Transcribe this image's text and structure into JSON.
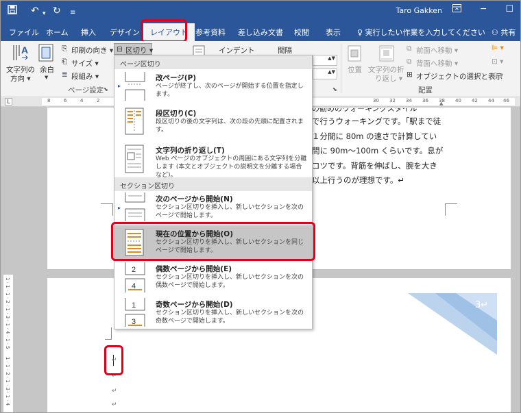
{
  "title_bar": {
    "user_name": "Taro Gakken",
    "qa_icons": [
      "save-icon",
      "undo-icon",
      "redo-icon",
      "customize-icon"
    ],
    "window_icons": [
      "ribbon-display-icon",
      "minimize-icon",
      "maximize-icon"
    ]
  },
  "tabs": [
    {
      "label": "ファイル"
    },
    {
      "label": "ホーム"
    },
    {
      "label": "挿入"
    },
    {
      "label": "デザイン"
    },
    {
      "label": "レイアウト",
      "active": true
    },
    {
      "label": "参考資料"
    },
    {
      "label": "差し込み文書"
    },
    {
      "label": "校閲"
    },
    {
      "label": "表示"
    }
  ],
  "tell_me": "実行したい作業を入力してください",
  "share": "共有",
  "ribbon": {
    "text_direction": {
      "line1": "文字列の",
      "line2": "方向 ▾"
    },
    "margins": "余白",
    "orientation": "印刷の向き ▾",
    "size": "サイズ ▾",
    "columns": "段組み ▾",
    "breaks": "区切り ▾",
    "page_setup_group": "ページ設定",
    "indent": "インデント",
    "spacing": "間隔",
    "position": "位置",
    "wrap_text": {
      "line1": "文字列の折",
      "line2": "り返し ▾"
    },
    "bring_forward": "前面へ移動 ▾",
    "send_backward": "背面へ移動 ▾",
    "selection_pane": "オブジェクトの選択と表示",
    "arrange_group": "配置"
  },
  "ruler": {
    "left_numbers": [
      "8",
      "6",
      "4",
      "2"
    ],
    "right_numbers": [
      "30",
      "32",
      "34",
      "36",
      "38",
      "40",
      "42",
      "44",
      "46",
      "48"
    ],
    "vertical": "1 · 1 · 1 · 2 · 1 · 3 · 1 · 4 · 1 · 5",
    "vertical_bottom": "1 · 1 · 2 · 1 · 3 · 1 · 4"
  },
  "document": {
    "lines": [
      "の勧めのウォーキングスタイル",
      "で行うウォーキングです。「駅まで徒",
      "１分間に 80m の速さで計算してい",
      "間に 90m～100m くらいです。息が",
      "コツです。背筋を伸ばし、腕を大き",
      "以上行うのが理想です。↵"
    ],
    "page_number": "3↵",
    "para_mark": "↵"
  },
  "menu": {
    "page_breaks_header": "ページ区切り",
    "section_breaks_header": "セクション区切り",
    "items": [
      {
        "title": "改ページ(P)",
        "desc": "ページが終了し、次のページが開始する位置を指定します。"
      },
      {
        "title": "段区切り(C)",
        "desc": "段区切りの後の文字列は、次の段の先頭に配置されます。"
      },
      {
        "title": "文字列の折り返し(T)",
        "desc": "Web ページのオブジェクトの周囲にある文字列を分離します (本文とオブジェクトの説明文を分離する場合など)。"
      },
      {
        "title": "次のページから開始(N)",
        "desc": "セクション区切りを挿入し、新しいセクションを次のページで開始します。"
      },
      {
        "title": "現在の位置から開始(O)",
        "desc": "セクション区切りを挿入し、新しいセクションを同じページで開始します。",
        "selected": true
      },
      {
        "title": "偶数ページから開始(E)",
        "desc": "セクション区切りを挿入し、新しいセクションを次の偶数ページで開始します。"
      },
      {
        "title": "奇数ページから開始(D)",
        "desc": "セクション区切りを挿入し、新しいセクションを次の奇数ページで開始します。"
      }
    ]
  },
  "colors": {
    "word_blue": "#2b579a",
    "highlight_red": "#e0001b",
    "selected_item": "#c6c6c6"
  }
}
